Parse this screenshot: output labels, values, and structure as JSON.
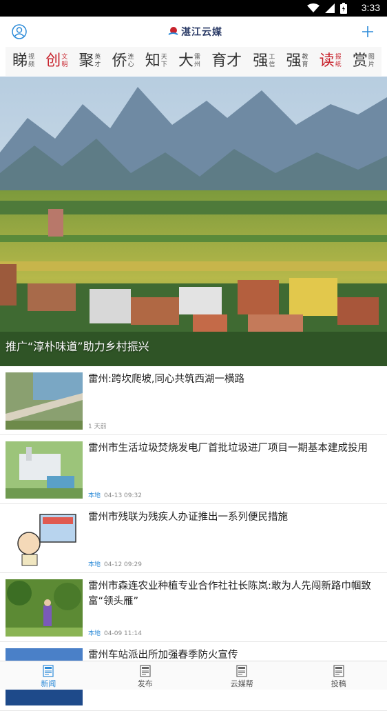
{
  "status_bar": {
    "time": "3:33",
    "icons": [
      "wifi-icon",
      "signal-icon",
      "battery-icon"
    ]
  },
  "app_bar": {
    "logo_text": "湛江云媒",
    "left_icon": "user-icon",
    "right_icon": "plus-icon"
  },
  "channels": [
    {
      "big": "睇",
      "small": [
        "视",
        "频"
      ],
      "big_color": "#333333"
    },
    {
      "big": "创",
      "small": [
        "文",
        "明"
      ],
      "big_color": "#c8232d"
    },
    {
      "big": "聚",
      "small": [
        "英",
        "才"
      ],
      "big_color": "#333333"
    },
    {
      "big": "侨",
      "small": [
        "连",
        "心"
      ],
      "big_color": "#333333"
    },
    {
      "big": "知",
      "small": [
        "天",
        "下"
      ],
      "big_color": "#333333"
    },
    {
      "big": "大",
      "small": [
        "雷",
        "州"
      ],
      "big_color": "#333333"
    },
    {
      "big": "育才",
      "small": [],
      "big_color": "#333333"
    },
    {
      "big": "强",
      "small": [
        "工",
        "信"
      ],
      "big_color": "#333333"
    },
    {
      "big": "强",
      "small": [
        "教",
        "育"
      ],
      "big_color": "#333333"
    },
    {
      "big": "读",
      "small": [
        "报",
        "纸"
      ],
      "big_color": "#c8232d"
    },
    {
      "big": "赏",
      "small": [
        "图",
        "片"
      ],
      "big_color": "#333333"
    }
  ],
  "hero": {
    "caption": "推广“淳朴味道”助力乡村振兴"
  },
  "news": [
    {
      "title": "雷州:跨坎爬坡,同心共筑西湖一横路",
      "tag": "",
      "time": "1 天前",
      "thumb": "road-lake-photo"
    },
    {
      "title": "雷州市生活垃圾焚烧发电厂首批垃圾进厂项目一期基本建成投用",
      "tag": "本地",
      "time": "04-13 09:32",
      "thumb": "power-plant-photo"
    },
    {
      "title": "雷州市残联为残疾人办证推出一系列便民措施",
      "tag": "本地",
      "time": "04-12 09:29",
      "thumb": "cartoon-illustration"
    },
    {
      "title": "雷州市森连农业种植专业合作社社长陈岚:敢为人先闯新路巾帼致富“领头雁”",
      "tag": "本地",
      "time": "04-09 11:14",
      "thumb": "orchard-photo"
    },
    {
      "title": "雷州车站派出所加强春季防火宣传",
      "tag": "",
      "time": "",
      "thumb": "station-photo"
    }
  ],
  "tabs": [
    {
      "label": "新闻",
      "active": true
    },
    {
      "label": "发布",
      "active": false
    },
    {
      "label": "云媒帮",
      "active": false
    },
    {
      "label": "投稿",
      "active": false
    }
  ],
  "colors": {
    "accent": "#2b8ad8",
    "red": "#c8232d",
    "logo": "#2a3a66"
  }
}
